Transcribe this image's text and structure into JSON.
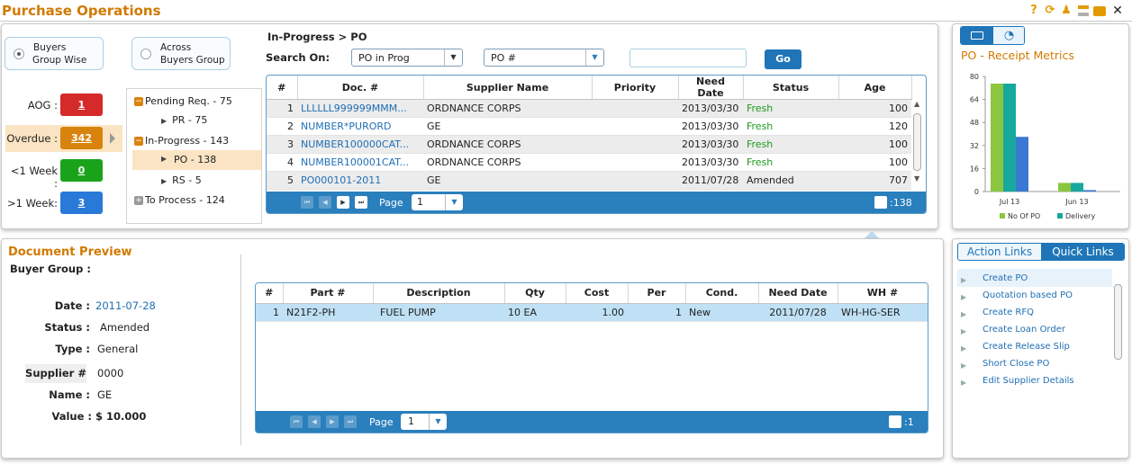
{
  "app": {
    "title": "Purchase Operations"
  },
  "toolbar_icons": [
    "help-icon",
    "refresh-icon",
    "user-settings-icon",
    "layout-icon",
    "camera-icon",
    "close-icon"
  ],
  "group_mode": {
    "options": [
      {
        "label_line1": "Buyers",
        "label_line2": "Group Wise",
        "selected": true
      },
      {
        "label_line1": "Across",
        "label_line2": "Buyers Group",
        "selected": false
      }
    ]
  },
  "status_counts": [
    {
      "label": "AOG :",
      "value": "1",
      "color": "#d42a2a"
    },
    {
      "label": "Overdue :",
      "value": "342",
      "color": "#d9830f"
    },
    {
      "label": "<1 Week :",
      "value": "0",
      "color": "#1aa31a"
    },
    {
      "label": ">1 Week:",
      "value": "3",
      "color": "#2979d9"
    }
  ],
  "tree": {
    "pending": "Pending Req. - 75",
    "pr": "PR - 75",
    "inprogress": "In-Progress - 143",
    "po": "PO - 138",
    "rs": "RS - 5",
    "toprocess": "To Process - 124"
  },
  "breadcrumb": "In-Progress > PO",
  "search": {
    "label": "Search On:",
    "category": "PO in Prog",
    "field": "PO #",
    "value": "",
    "go_label": "Go"
  },
  "po_grid": {
    "columns": [
      "#",
      "Doc. #",
      "Supplier Name",
      "Priority",
      "Need Date",
      "Status",
      "Age"
    ],
    "rows": [
      {
        "n": "1",
        "doc": "LLLLLL999999MMM...",
        "supplier": "ORDNANCE CORPS",
        "priority": "",
        "need": "2013/03/30",
        "status": "Fresh",
        "age": "100"
      },
      {
        "n": "2",
        "doc": "NUMBER*PURORD",
        "supplier": "GE",
        "priority": "",
        "need": "2013/03/30",
        "status": "Fresh",
        "age": "120"
      },
      {
        "n": "3",
        "doc": "NUMBER100000CAT...",
        "supplier": "ORDNANCE CORPS",
        "priority": "",
        "need": "2013/03/30",
        "status": "Fresh",
        "age": "100"
      },
      {
        "n": "4",
        "doc": "NUMBER100001CAT...",
        "supplier": "ORDNANCE CORPS",
        "priority": "",
        "need": "2013/03/30",
        "status": "Fresh",
        "age": "100"
      },
      {
        "n": "5",
        "doc": "PO000101-2011",
        "supplier": "GE",
        "priority": "",
        "need": "2011/07/28",
        "status": "Amended",
        "age": "707"
      }
    ],
    "footer": {
      "page_label": "Page",
      "page": "1",
      "count": ":138"
    }
  },
  "metrics": {
    "title": "PO - Receipt Metrics",
    "tabs": [
      "list-view-icon",
      "clock-search-icon"
    ]
  },
  "chart_data": {
    "type": "bar",
    "title": "",
    "categories": [
      "Jul 13",
      "Jun 13"
    ],
    "series": [
      {
        "name": "No Of PO",
        "values": [
          75,
          6
        ],
        "color": "#8cc63f"
      },
      {
        "name": "Delivery",
        "values": [
          75,
          6
        ],
        "color": "#17a89e"
      },
      {
        "name": "Quality",
        "values": [
          38,
          1
        ],
        "color": "#3a78d4"
      },
      {
        "name": "Rate",
        "values": [
          0,
          0
        ],
        "color": "#666666"
      }
    ],
    "yticks": [
      "0",
      "16",
      "32",
      "48",
      "64",
      "80"
    ],
    "ylim": [
      0,
      80
    ],
    "legend_position": "bottom"
  },
  "preview": {
    "title": "Document Preview",
    "buyer_group_label": "Buyer Group :",
    "fields": [
      {
        "label": "Date :",
        "value": "2011-07-28",
        "link": true
      },
      {
        "label": "Status :",
        "value": "Amended",
        "link": false
      },
      {
        "label": "Type :",
        "value": "General",
        "link": false
      },
      {
        "label": "Supplier #",
        "value": "0000",
        "link": false
      },
      {
        "label": "Name :",
        "value": "GE",
        "link": false
      },
      {
        "label": "Value :",
        "value": "$ 10.000",
        "link": false
      }
    ]
  },
  "lines_grid": {
    "columns": [
      "#",
      "Part #",
      "Description",
      "Qty",
      "Cost",
      "Per",
      "Cond.",
      "Need Date",
      "WH #"
    ],
    "rows": [
      {
        "n": "1",
        "part": "N21F2-PH",
        "desc": "FUEL PUMP",
        "qty": "10 EA",
        "cost": "1.00",
        "per": "1",
        "cond": "New",
        "need": "2011/07/28",
        "wh": "WH-HG-SER"
      }
    ],
    "footer": {
      "page_label": "Page",
      "page": "1",
      "count": ":1"
    }
  },
  "links": {
    "tabs": [
      "Action Links",
      "Quick Links"
    ],
    "items": [
      "Create PO",
      "Quotation based PO",
      "Create RFQ",
      "Create Loan Order",
      "Create Release Slip",
      "Short Close PO",
      "Edit Supplier Details"
    ]
  }
}
